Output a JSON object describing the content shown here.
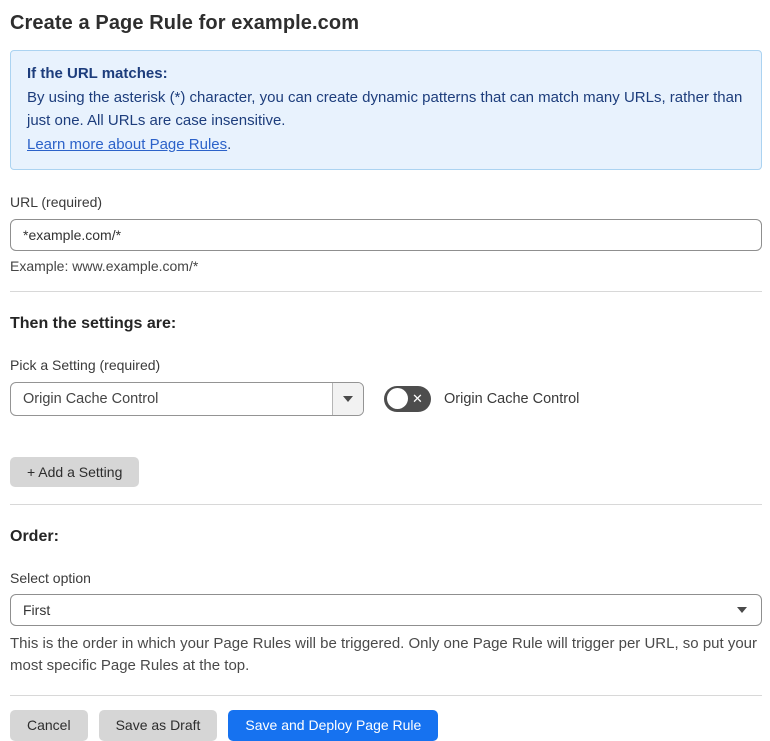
{
  "page": {
    "title": "Create a Page Rule for example.com"
  },
  "info_box": {
    "heading": "If the URL matches:",
    "body": "By using the asterisk (*) character, you can create dynamic patterns that can match many URLs, rather than just one. All URLs are case insensitive.",
    "link_label": "Learn more about Page Rules",
    "link_suffix": "."
  },
  "url_section": {
    "label": "URL (required)",
    "input_value": "*example.com/*",
    "helper": "Example: www.example.com/*"
  },
  "settings_section": {
    "heading": "Then the settings are:",
    "picker_label": "Pick a Setting (required)",
    "picker_value": "Origin Cache Control",
    "toggle_state": "off",
    "toggle_label": "Origin Cache Control",
    "add_button_label": "+ Add a Setting"
  },
  "order_section": {
    "heading": "Order:",
    "select_label": "Select option",
    "select_value": "First",
    "helper": "This is the order in which your Page Rules will be triggered. Only one Page Rule will trigger per URL, so put your most specific Page Rules at the top."
  },
  "footer": {
    "cancel_label": "Cancel",
    "save_draft_label": "Save as Draft",
    "save_deploy_label": "Save and Deploy Page Rule"
  },
  "icons": {
    "toggle_off_glyph": "✕"
  },
  "colors": {
    "info_bg": "#e8f2fd",
    "info_border": "#abd3f1",
    "info_text": "#1d3d7c",
    "link": "#2c62c9",
    "primary_button": "#1672f0",
    "toggle_off": "#4d4d4d",
    "gray_button": "#d6d6d6"
  }
}
